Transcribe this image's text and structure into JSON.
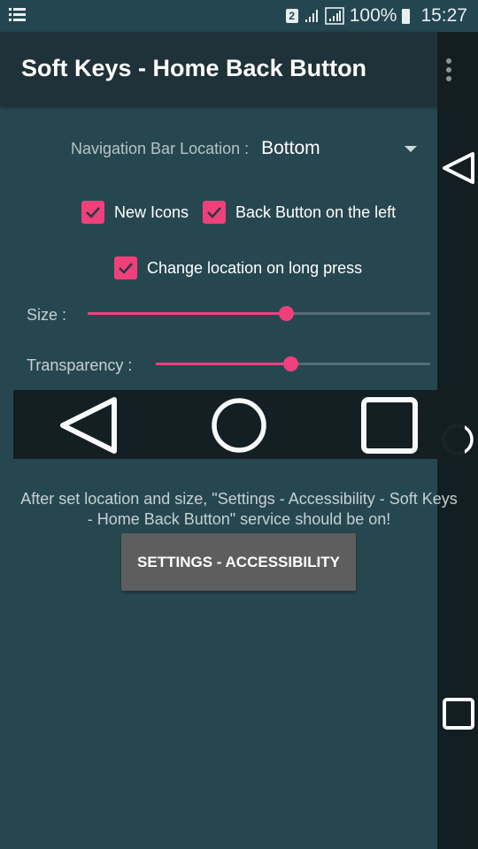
{
  "status_bar": {
    "notification_icon": "list-icon",
    "sim_label": "2",
    "battery_percent": "100%",
    "time": "15:27"
  },
  "app_bar": {
    "title": "Soft Keys - Home Back Button",
    "overflow_icon": "more-vert-icon"
  },
  "settings": {
    "location_label": "Navigation Bar Location :",
    "location_value": "Bottom",
    "checkboxes": [
      {
        "label": "New Icons",
        "checked": true
      },
      {
        "label": "Back Button on the left",
        "checked": true
      },
      {
        "label": "Change location on long press",
        "checked": true
      }
    ],
    "size_label": "Size :",
    "size_value": 0.58,
    "transparency_label": "Transparency :",
    "transparency_value": 0.49
  },
  "info_text": "After set location and size, \"Settings - Accessibility - Soft Keys - Home Back Button\" service should be on!",
  "settings_button": "SETTINGS - ACCESSIBILITY",
  "colors": {
    "accent": "#f0407a",
    "background": "#274750",
    "app_bar": "#1f3139",
    "nav_bar": "#131e22"
  }
}
